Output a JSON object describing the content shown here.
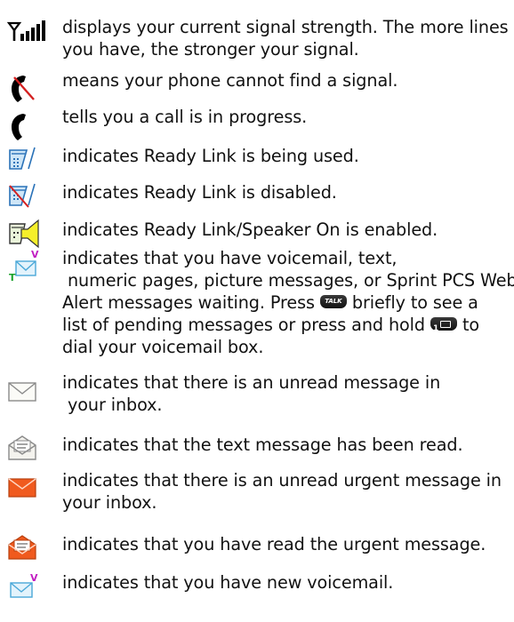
{
  "items": [
    {
      "icon": "signal-strength-icon",
      "text": "displays your current signal strength. The more lines you have, the stronger your signal."
    },
    {
      "icon": "no-signal-icon",
      "text": "means your phone cannot find a signal."
    },
    {
      "icon": "call-in-progress-icon",
      "text": "tells you a call is in progress."
    },
    {
      "icon": "ready-link-icon",
      "text": "indicates Ready Link is being used."
    },
    {
      "icon": "ready-link-disabled-icon",
      "text": "indicates Ready Link is disabled."
    },
    {
      "icon": "ready-link-speaker-icon",
      "text": "indicates Ready Link/Speaker On is enabled."
    },
    {
      "icon": "messages-waiting-icon",
      "text_line1": "indicates that you have voicemail, text,",
      "text_line2": " numeric pages, picture messages, or Sprint PCS Web",
      "text_line3a": "Alert messages waiting. Press",
      "text_line3b": "briefly to see a",
      "text_line4a": "list of pending messages or press and hold",
      "text_line4b": "to",
      "text_line5": "dial your voicemail box.",
      "talk_key_label": "TALK",
      "one_key_label": "1"
    },
    {
      "icon": "unread-message-icon",
      "text_line1": "indicates that there is an unread message in",
      "text_line2": " your inbox."
    },
    {
      "icon": "read-message-icon",
      "text": "indicates that the text message has been read."
    },
    {
      "icon": "unread-urgent-message-icon",
      "text_line1": "indicates that there is an unread urgent message in",
      "text_line2": "your inbox."
    },
    {
      "icon": "read-urgent-message-icon",
      "text": "indicates that you have read the urgent message."
    },
    {
      "icon": "new-voicemail-icon",
      "text": "indicates that you have new voicemail."
    }
  ]
}
